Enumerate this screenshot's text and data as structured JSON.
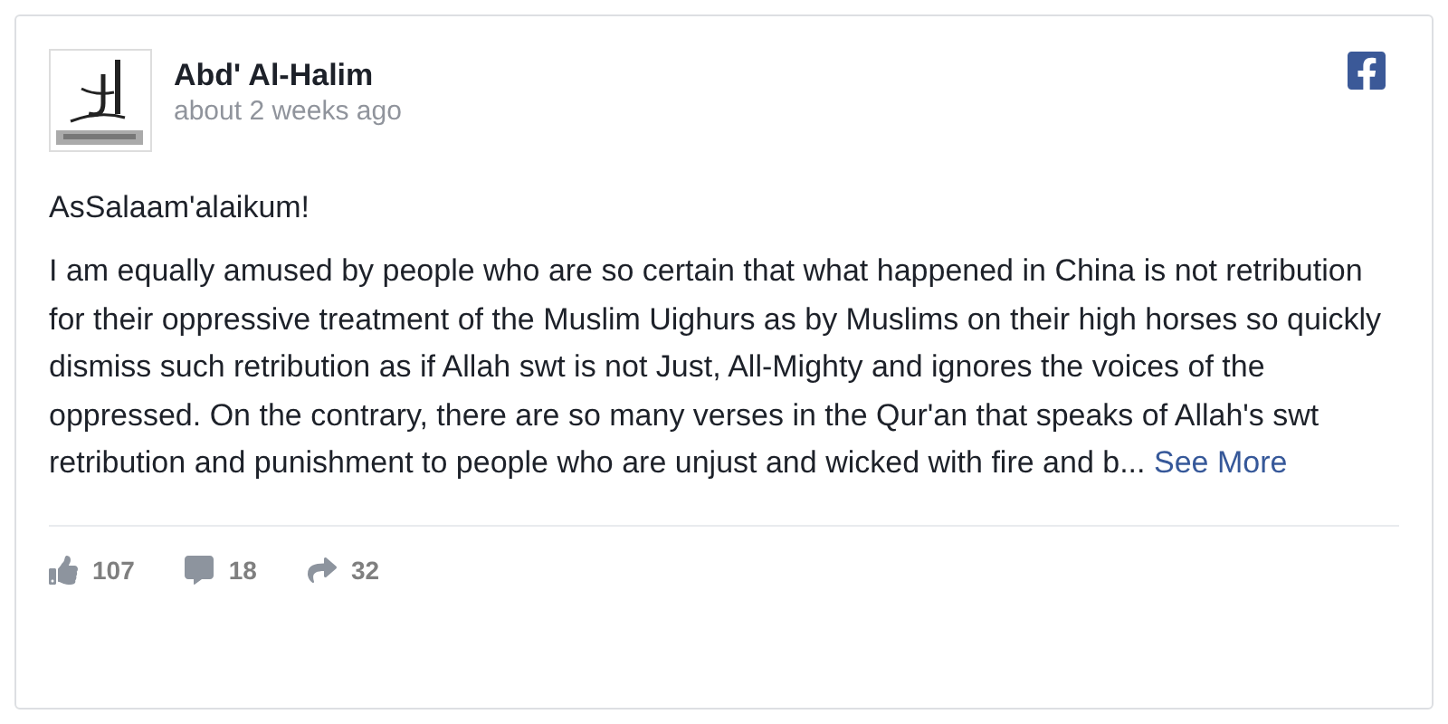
{
  "post": {
    "author": "Abd' Al-Halim",
    "time": "about 2 weeks ago",
    "greeting": "AsSalaam'alaikum!",
    "body": "I am equally amused by people who are so certain that what happened in China is not retribution for their oppressive treatment of the Muslim Uighurs as by Muslims on their high horses so quickly dismiss such retribution as if Allah swt is not Just, All-Mighty and ignores the voices of the oppressed. On the contrary, there are so many verses in the Qur'an that speaks of Allah's swt retribution and punishment to people who are unjust and wicked with fire and b...",
    "see_more": "See More"
  },
  "stats": [
    {
      "kind": "like",
      "count": "107"
    },
    {
      "kind": "comment",
      "count": "18"
    },
    {
      "kind": "share",
      "count": "32"
    }
  ]
}
